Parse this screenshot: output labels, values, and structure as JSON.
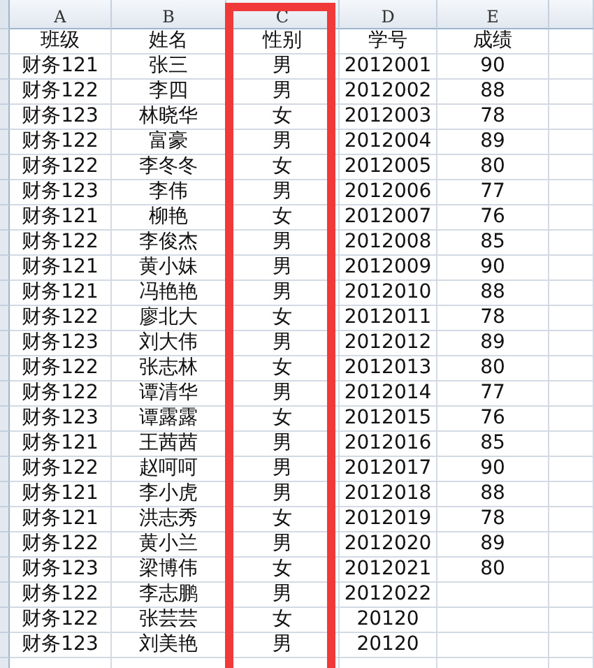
{
  "columns": [
    {
      "letter": "A",
      "highlighted": false
    },
    {
      "letter": "B",
      "highlighted": false
    },
    {
      "letter": "C",
      "highlighted": true
    },
    {
      "letter": "D",
      "highlighted": false
    },
    {
      "letter": "E",
      "highlighted": false
    }
  ],
  "rows": [
    [
      "班级",
      "姓名",
      "性别",
      "学号",
      "成绩"
    ],
    [
      "财务121",
      "张三",
      "男",
      "2012001",
      "90"
    ],
    [
      "财务122",
      "李四",
      "男",
      "2012002",
      "88"
    ],
    [
      "财务123",
      "林晓华",
      "女",
      "2012003",
      "78"
    ],
    [
      "财务122",
      "富豪",
      "男",
      "2012004",
      "89"
    ],
    [
      "财务122",
      "李冬冬",
      "女",
      "2012005",
      "80"
    ],
    [
      "财务123",
      "李伟",
      "男",
      "2012006",
      "77"
    ],
    [
      "财务121",
      "柳艳",
      "女",
      "2012007",
      "76"
    ],
    [
      "财务122",
      "李俊杰",
      "男",
      "2012008",
      "85"
    ],
    [
      "财务121",
      "黄小妹",
      "男",
      "2012009",
      "90"
    ],
    [
      "财务121",
      "冯艳艳",
      "男",
      "2012010",
      "88"
    ],
    [
      "财务122",
      "廖北大",
      "女",
      "2012011",
      "78"
    ],
    [
      "财务123",
      "刘大伟",
      "男",
      "2012012",
      "89"
    ],
    [
      "财务122",
      "张志林",
      "女",
      "2012013",
      "80"
    ],
    [
      "财务122",
      "谭清华",
      "男",
      "2012014",
      "77"
    ],
    [
      "财务123",
      "谭露露",
      "女",
      "2012015",
      "76"
    ],
    [
      "财务121",
      "王茜茜",
      "男",
      "2012016",
      "85"
    ],
    [
      "财务122",
      "赵呵呵",
      "男",
      "2012017",
      "90"
    ],
    [
      "财务121",
      "李小虎",
      "男",
      "2012018",
      "88"
    ],
    [
      "财务121",
      "洪志秀",
      "女",
      "2012019",
      "78"
    ],
    [
      "财务122",
      "黄小兰",
      "男",
      "2012020",
      "89"
    ],
    [
      "财务123",
      "梁博伟",
      "女",
      "2012021",
      "80"
    ],
    [
      "财务122",
      "李志鹏",
      "男",
      "2012022"
    ],
    [
      "财务122",
      "张芸芸",
      "女",
      "20120"
    ],
    [
      "财务123",
      "刘美艳",
      "男",
      "20120"
    ]
  ]
}
